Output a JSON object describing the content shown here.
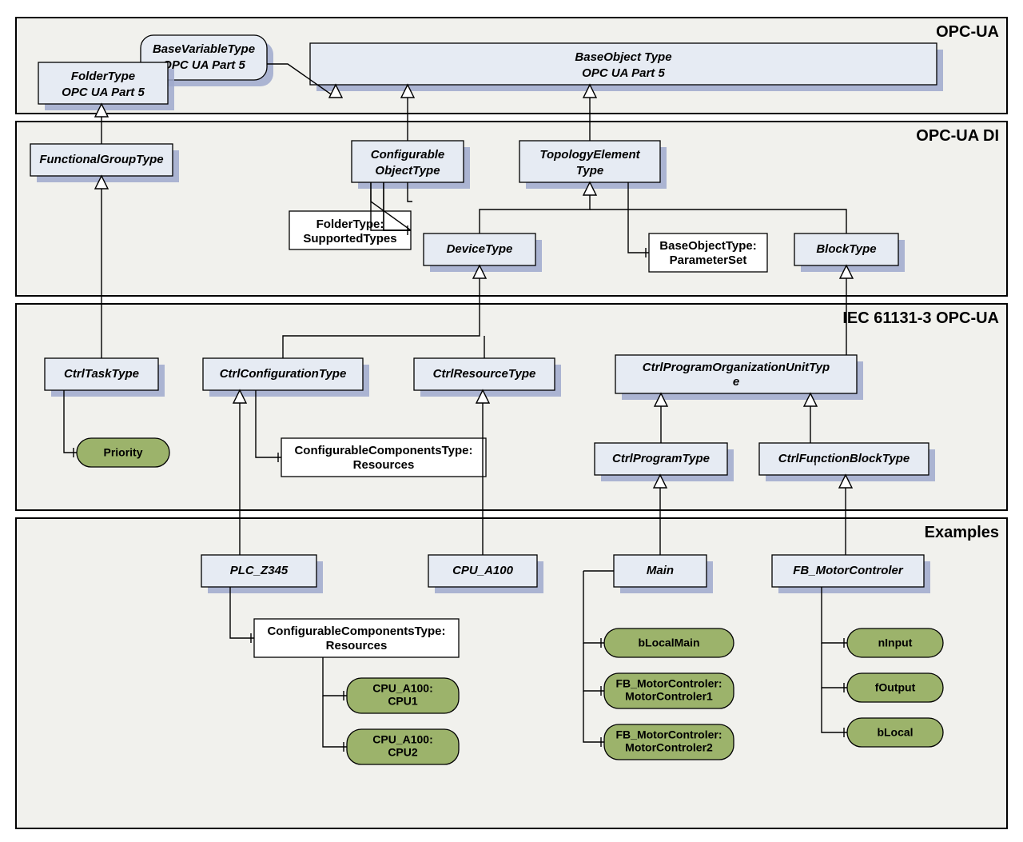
{
  "layers": [
    {
      "key": "opcua",
      "label": "OPC-UA"
    },
    {
      "key": "di",
      "label": "OPC-UA DI"
    },
    {
      "key": "iec",
      "label": "IEC 61131-3 OPC-UA"
    },
    {
      "key": "ex",
      "label": "Examples"
    }
  ],
  "nodes": {
    "folderType": {
      "line1": "FolderType",
      "line2": "OPC UA Part 5"
    },
    "baseVarType": {
      "line1": "BaseVariableType",
      "line2": "OPC UA Part 5"
    },
    "baseObjType": {
      "line1": "BaseObject Type",
      "line2": "OPC UA Part 5"
    },
    "funcGroup": {
      "line1": "FunctionalGroupType"
    },
    "configObj": {
      "line1": "Configurable",
      "line2": "ObjectType"
    },
    "topoElem": {
      "line1": "TopologyElement",
      "line2": "Type"
    },
    "folderSupported": {
      "line1": "FolderType:",
      "line2": "SupportedTypes"
    },
    "deviceType": {
      "line1": "DeviceType"
    },
    "paramSet": {
      "line1": "BaseObjectType:",
      "line2": "ParameterSet"
    },
    "blockType": {
      "line1": "BlockType"
    },
    "ctrlTask": {
      "line1": "CtrlTaskType"
    },
    "ctrlConfig": {
      "line1": "CtrlConfigurationType"
    },
    "ctrlResource": {
      "line1": "CtrlResourceType"
    },
    "ctrlPOU": {
      "line1": "CtrlProgramOrganizationUnitTyp",
      "line2": "e"
    },
    "confCompRes": {
      "line1": "ConfigurableComponentsType:",
      "line2": "Resources"
    },
    "ctrlProgram": {
      "line1": "CtrlProgramType"
    },
    "ctrlFB": {
      "line1": "CtrlFunctionBlockType"
    },
    "plc": {
      "line1": "PLC_Z345"
    },
    "cpu": {
      "line1": "CPU_A100"
    },
    "main": {
      "line1": "Main"
    },
    "fbMotor": {
      "line1": "FB_MotorControler"
    },
    "confCompRes2": {
      "line1": "ConfigurableComponentsType:",
      "line2": "Resources"
    }
  },
  "pills": {
    "priority": "Priority",
    "cpuA1": "CPU_A100:\nCPU1",
    "cpuA2": "CPU_A100:\nCPU2",
    "bLocalMain": "bLocalMain",
    "fbMC1": "FB_MotorControler:\nMotorControler1",
    "fbMC2": "FB_MotorControler:\nMotorControler2",
    "nInput": "nInput",
    "fOutput": "fOutput",
    "bLocal": "bLocal"
  }
}
